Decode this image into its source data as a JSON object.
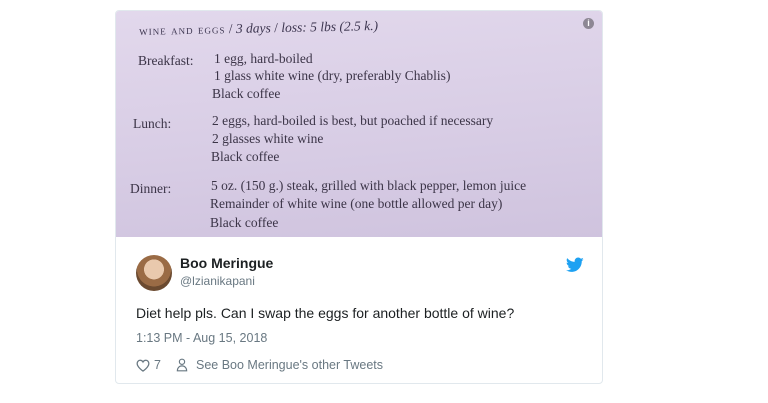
{
  "image": {
    "heading_title": "Wine and Eggs",
    "heading_days": "3 days",
    "heading_loss": "loss: 5 lbs (2.5 k.)",
    "meals": [
      {
        "label": "Breakfast:",
        "lines": [
          "1 egg, hard-boiled",
          "1 glass white wine (dry, preferably Chablis)",
          "Black coffee"
        ]
      },
      {
        "label": "Lunch:",
        "lines": [
          "2 eggs, hard-boiled is best, but poached if necessary",
          "2 glasses white wine",
          "Black coffee"
        ]
      },
      {
        "label": "Dinner:",
        "lines": [
          "5 oz. (150 g.) steak, grilled with black pepper, lemon juice",
          "Remainder of white wine (one bottle allowed per day)",
          "Black coffee"
        ]
      }
    ]
  },
  "tweet": {
    "name": "Boo Meringue",
    "handle": "@lzianikapani",
    "text": "Diet help pls. Can I swap the eggs for another bottle of wine?",
    "timestamp": "1:13 PM - Aug 15, 2018",
    "likes": "7",
    "other_tweets_label": "See Boo Meringue's other Tweets"
  },
  "colors": {
    "twitter_blue": "#1da1f2",
    "meta_gray": "#697882",
    "photo_bg": "#d8cde5"
  },
  "icons": [
    "info-icon",
    "twitter-bird-icon",
    "heart-icon",
    "person-icon"
  ]
}
